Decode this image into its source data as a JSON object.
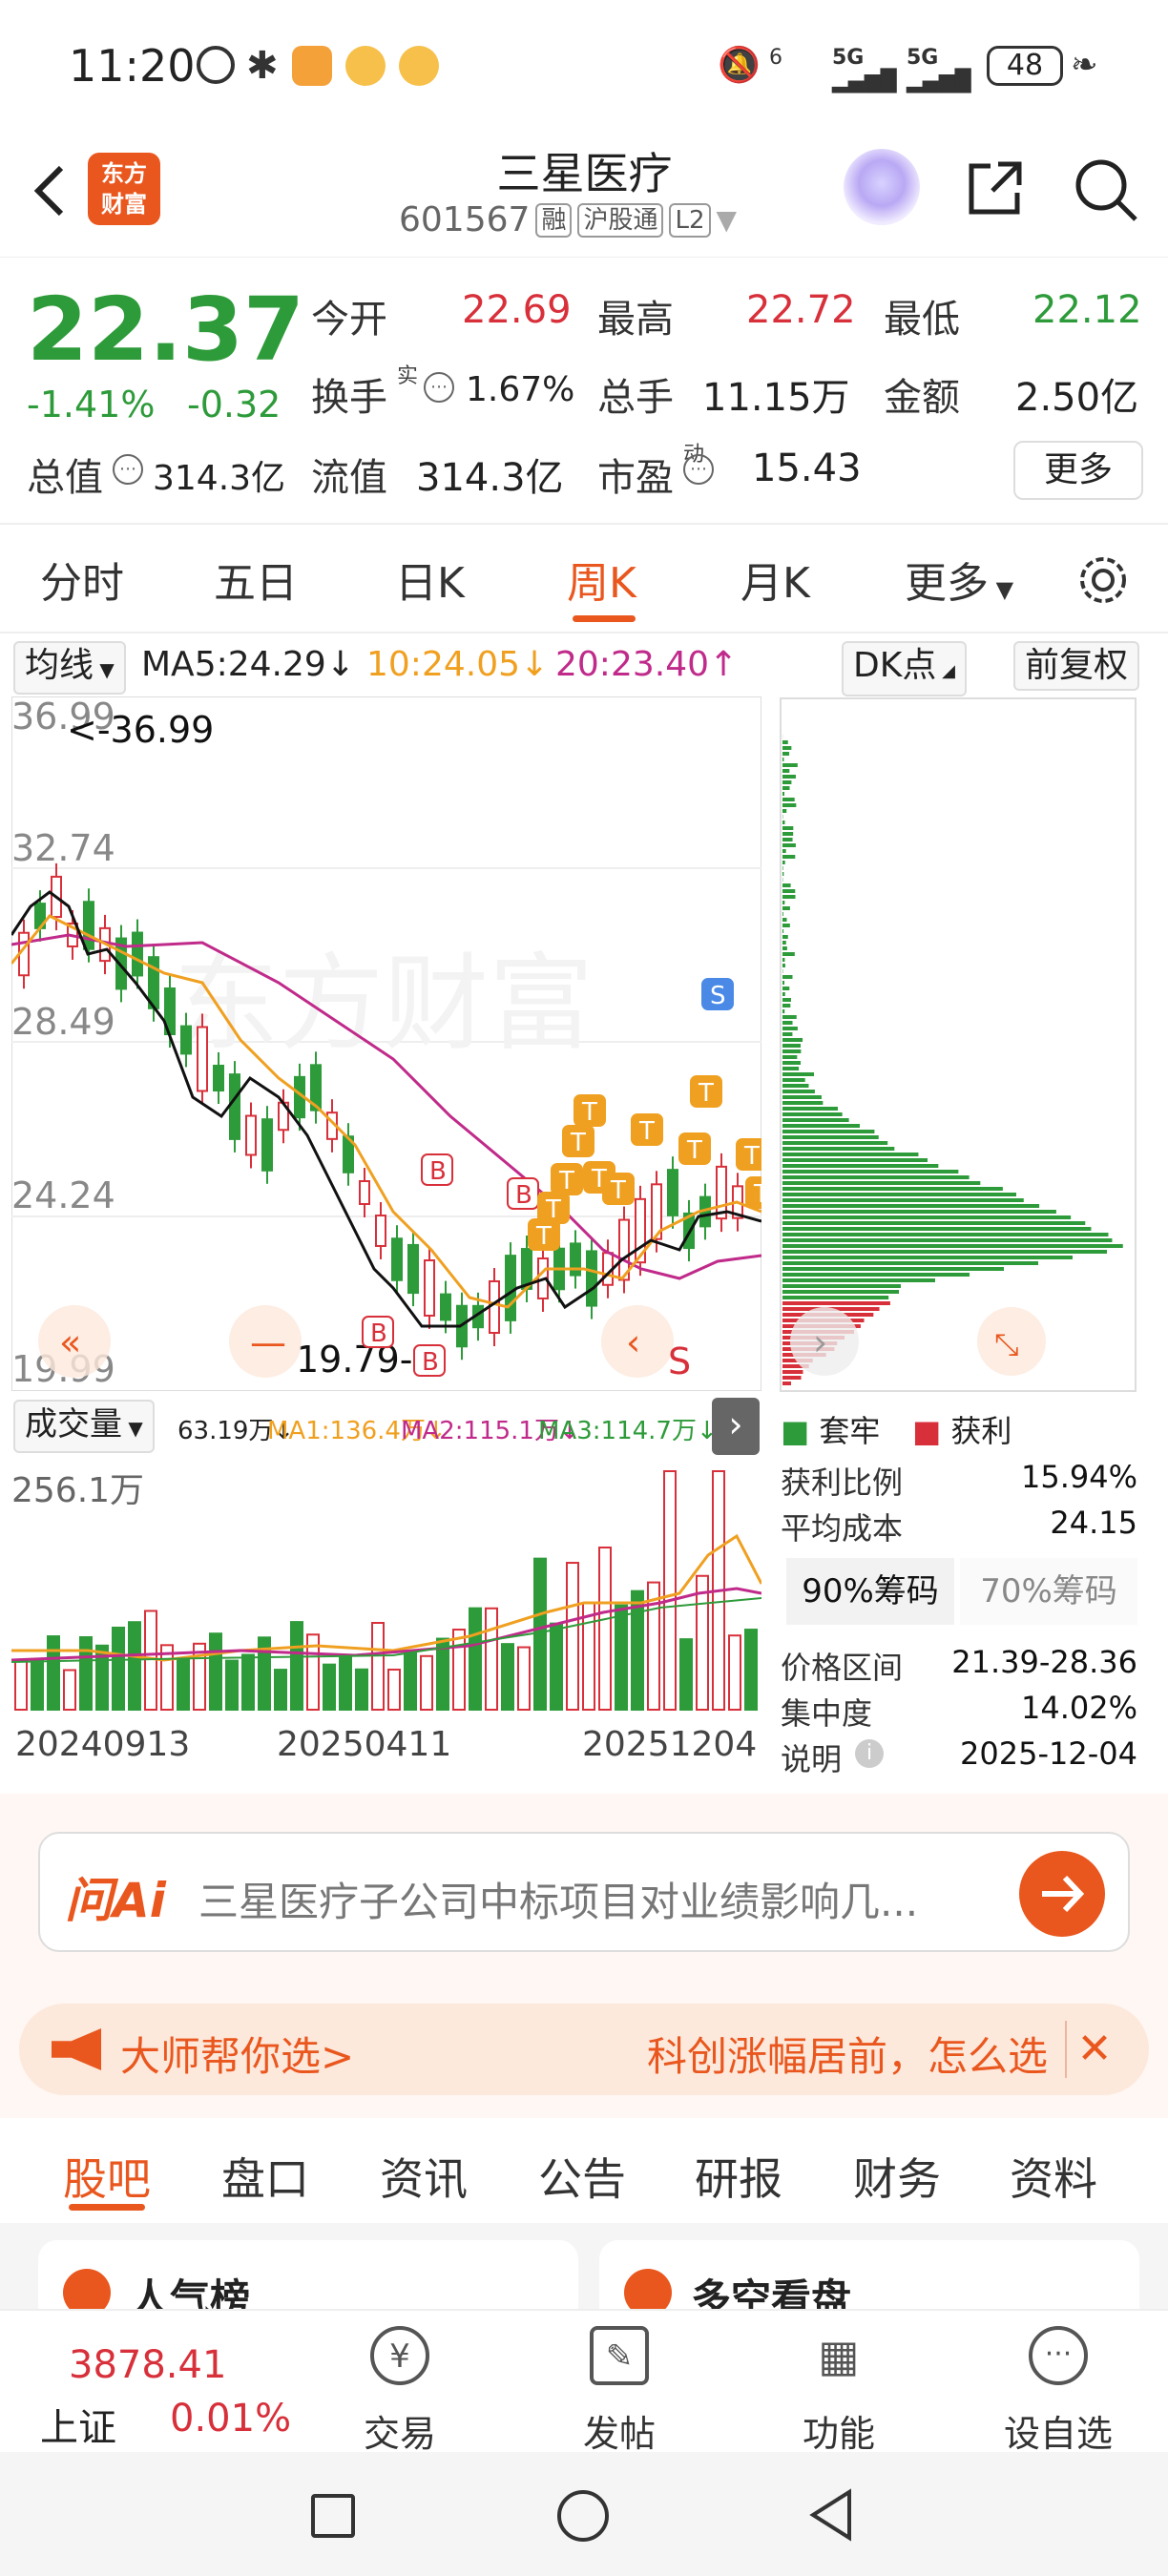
{
  "status_bar": {
    "time": "11:20",
    "wifi_label": "6",
    "sim1": "5G",
    "sim2": "5G",
    "battery": "48"
  },
  "header": {
    "logo_line1": "东方",
    "logo_line2": "财富",
    "title": "三星医疗",
    "code": "601567",
    "tags": [
      "融",
      "沪股通",
      "L2"
    ]
  },
  "quote": {
    "price": "22.37",
    "change_pct": "-1.41%",
    "change": "-0.32",
    "open_label": "今开",
    "open": "22.69",
    "high_label": "最高",
    "high": "22.72",
    "low_label": "最低",
    "low": "22.12",
    "turnover_label": "换手",
    "turnover_sup": "实",
    "turnover": "1.67%",
    "volume_label": "总手",
    "volume": "11.15万",
    "amount_label": "金额",
    "amount": "2.50亿",
    "mcap_label": "总值",
    "mcap": "314.3亿",
    "float_label": "流值",
    "float": "314.3亿",
    "pe_label": "市盈",
    "pe_sup": "动",
    "pe": "15.43",
    "more_button": "更多"
  },
  "period_tabs": [
    "分时",
    "五日",
    "日K",
    "周K",
    "月K",
    "更多"
  ],
  "period_active": "周K",
  "ma_row": {
    "selector": "均线",
    "ma5": "MA5:24.29↓",
    "ma10": "10:24.05↓",
    "ma20": "20:23.40↑",
    "dk_button": "DK点",
    "adjust_button": "前复权"
  },
  "kchart": {
    "y_labels": [
      "36.99",
      "32.74",
      "28.49",
      "24.24",
      "19.99"
    ],
    "max_annotation": "<-36.99",
    "min_annotation": "19.79->",
    "watermark": "东方财富",
    "marker_S": "S",
    "marker_B": "B",
    "marker_T": "T"
  },
  "chip_legend": {
    "trapped": "套牢",
    "profit": "获利"
  },
  "volume_header": {
    "selector": "成交量",
    "vol": "63.19万↓",
    "ma1": "MA1:136.4万↓",
    "ma2": "MA2:115.1万↓",
    "ma3": "MA3:114.7万↓"
  },
  "volume_chart": {
    "max_label": "256.1万",
    "dates": [
      "20240913",
      "20250411",
      "20251204"
    ]
  },
  "chip_stats": {
    "profit_ratio_label": "获利比例",
    "profit_ratio": "15.94%",
    "avg_cost_label": "平均成本",
    "avg_cost": "24.15",
    "tab_90": "90%筹码",
    "tab_70": "70%筹码",
    "price_range_label": "价格区间",
    "price_range": "21.39-28.36",
    "concentration_label": "集中度",
    "concentration": "14.02%",
    "note_label": "说明",
    "note_date": "2025-12-04"
  },
  "ai_bar": {
    "brand": "问Ai",
    "question": "三星医疗子公司中标项目对业绩影响几..."
  },
  "promo": {
    "left": "大师帮你选>",
    "right": "科创涨幅居前，怎么选"
  },
  "content_tabs": [
    "股吧",
    "盘口",
    "资讯",
    "公告",
    "研报",
    "财务",
    "资料"
  ],
  "content_active": "股吧",
  "cards": {
    "left": "人气榜",
    "right": "多空看盘"
  },
  "bottom_bar": {
    "index_value": "3878.41",
    "index_name": "上证",
    "index_change": "0.01%",
    "items": [
      "交易",
      "发帖",
      "功能",
      "设自选"
    ]
  },
  "colors": {
    "accent": "#e9571e",
    "up": "#d8303a",
    "down": "#2e9b3a",
    "ma10": "#f0a020",
    "ma20": "#c02a8a"
  }
}
